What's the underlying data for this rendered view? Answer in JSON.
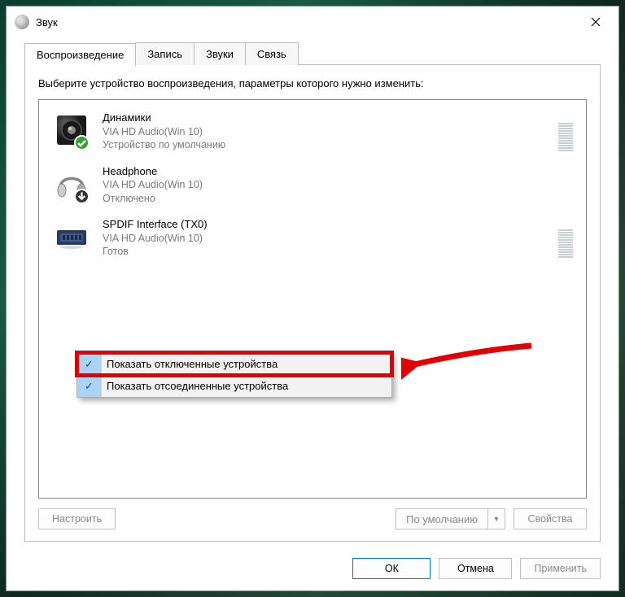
{
  "window": {
    "title": "Звук"
  },
  "tabs": [
    {
      "label": "Воспроизведение",
      "active": true
    },
    {
      "label": "Запись",
      "active": false
    },
    {
      "label": "Звуки",
      "active": false
    },
    {
      "label": "Связь",
      "active": false
    }
  ],
  "instruction": "Выберите устройство воспроизведения, параметры которого нужно изменить:",
  "devices": [
    {
      "name": "Динамики",
      "driver": "VIA HD Audio(Win 10)",
      "status": "Устройство по умолчанию",
      "icon": "speaker",
      "badge": "check-green",
      "meter": true
    },
    {
      "name": "Headphone",
      "driver": "VIA HD Audio(Win 10)",
      "status": "Отключено",
      "icon": "headphone",
      "badge": "down-dark",
      "meter": false
    },
    {
      "name": "SPDIF Interface (TX0)",
      "driver": "VIA HD Audio(Win 10)",
      "status": "Готов",
      "icon": "spdif",
      "badge": null,
      "meter": true
    }
  ],
  "context_menu": [
    {
      "label": "Показать отключенные устройства",
      "checked": true,
      "highlighted": true
    },
    {
      "label": "Показать отсоединенные устройства",
      "checked": true,
      "highlighted": false
    }
  ],
  "panel_buttons": {
    "configure": "Настроить",
    "set_default": "По умолчанию",
    "properties": "Свойства"
  },
  "footer": {
    "ok": "ОК",
    "cancel": "Отмена",
    "apply": "Применить"
  }
}
